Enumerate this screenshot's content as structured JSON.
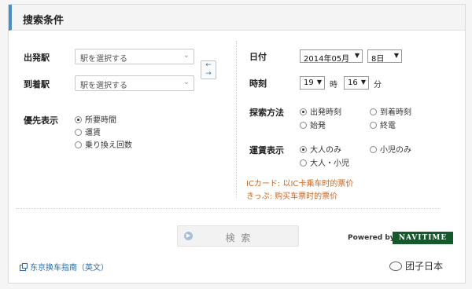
{
  "header": {
    "title": "搜索条件"
  },
  "departure": {
    "label": "出発駅",
    "placeholder": "駅を選択する"
  },
  "arrival": {
    "label": "到着駅",
    "placeholder": "駅を選択する"
  },
  "priority": {
    "label": "優先表示",
    "options": [
      "所要時間",
      "運賃",
      "乗り換え回数"
    ],
    "selected": 0
  },
  "date": {
    "label": "日付",
    "month_value": "2014年05月",
    "day_value": "8日"
  },
  "time": {
    "label": "時刻",
    "hour_value": "19",
    "hour_unit": "時",
    "minute_value": "16",
    "minute_unit": "分"
  },
  "search_method": {
    "label": "探索方法",
    "options": [
      "出発時刻",
      "到着時刻",
      "始発",
      "終電"
    ],
    "selected": 0
  },
  "fare_display": {
    "label": "運賃表示",
    "options": [
      "大人のみ",
      "小児のみ",
      "大人・小児"
    ],
    "selected": 0
  },
  "notes": [
    "ICカード: 以IC卡乘车时的票价",
    "きっぷ: 购买车票时的票价"
  ],
  "search_button": {
    "label": "検 索"
  },
  "powered": {
    "label": "Powered by",
    "brand": "NAVITIME"
  },
  "guide_link": {
    "label": "东京换车指南（英文）"
  },
  "watermark": {
    "label": "团子日本"
  },
  "colors": {
    "accent": "#4b8fc2",
    "note": "#c0692a",
    "brand_bg": "#14592b",
    "link": "#2f6aa5"
  }
}
